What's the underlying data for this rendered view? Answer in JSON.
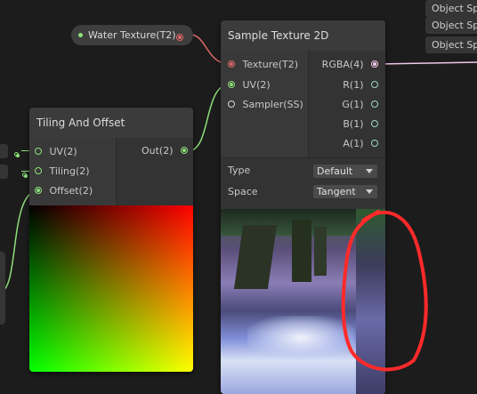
{
  "top_right_buttons": [
    "Object Spa",
    "Object Spa",
    "Object Spa"
  ],
  "water_texture_node": {
    "label": "Water Texture(T2)"
  },
  "sample_texture_node": {
    "title": "Sample Texture 2D",
    "inputs": [
      "Texture(T2)",
      "UV(2)",
      "Sampler(SS)"
    ],
    "outputs": [
      "RGBA(4)",
      "R(1)",
      "G(1)",
      "B(1)",
      "A(1)"
    ],
    "type_label": "Type",
    "type_value": "Default",
    "space_label": "Space",
    "space_value": "Tangent"
  },
  "tiling_offset_node": {
    "title": "Tiling And Offset",
    "inputs": [
      "UV(2)",
      "Tiling(2)",
      "Offset(2)"
    ],
    "output": "Out(2)"
  },
  "colors": {
    "texture_port": "#e06868",
    "vector2_port": "#8ee07a",
    "vector4_port": "#f0c8ec",
    "annotation": "#ff2a2a"
  }
}
